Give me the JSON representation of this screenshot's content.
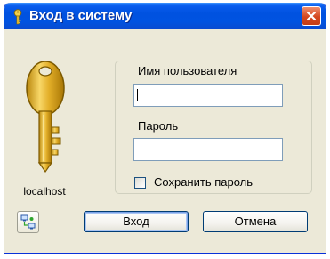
{
  "window": {
    "title": "Вход в систему"
  },
  "host": {
    "label": "localhost"
  },
  "form": {
    "username_label": "Имя пользователя",
    "username_value": "",
    "password_label": "Пароль",
    "password_value": "",
    "save_password_label": "Сохранить пароль",
    "save_password_checked": false
  },
  "buttons": {
    "login": "Вход",
    "cancel": "Отмена"
  },
  "colors": {
    "titlebar": "#0054e3",
    "dialog_bg": "#ece9d8",
    "key_gold": "#d4a017"
  },
  "icons": {
    "title": "key-icon",
    "close": "close-icon",
    "main": "key-icon",
    "network": "network-icon"
  }
}
